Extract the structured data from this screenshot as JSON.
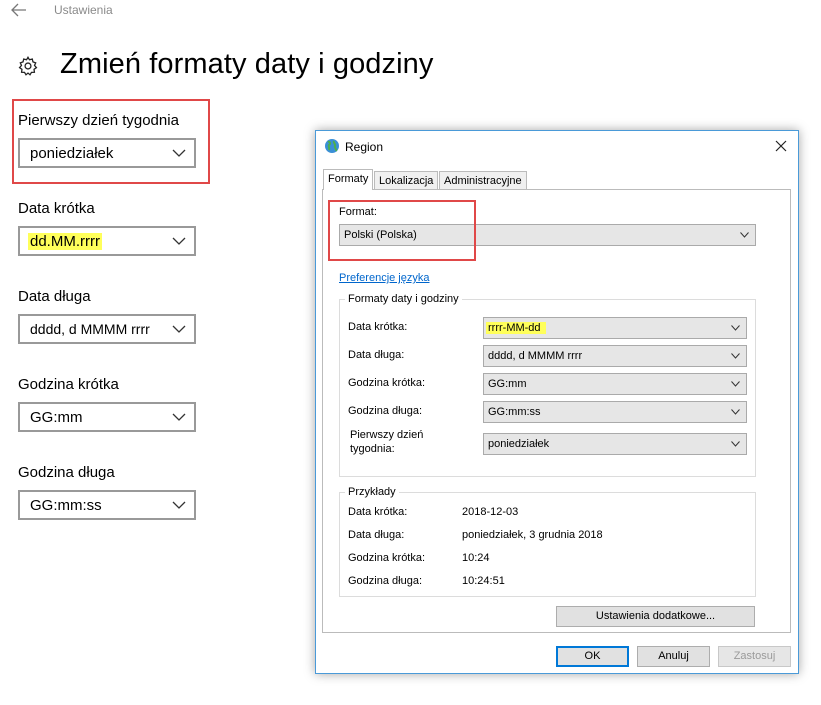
{
  "settings": {
    "app_title": "Ustawienia",
    "page_title": "Zmień formaty daty i godziny",
    "fields": [
      {
        "label": "Pierwszy dzień tygodnia",
        "value": "poniedziałek"
      },
      {
        "label": "Data krótka",
        "value": "dd.MM.rrrr"
      },
      {
        "label": "Data długa",
        "value": "dddd, d MMMM rrrr"
      },
      {
        "label": "Godzina krótka",
        "value": "GG:mm"
      },
      {
        "label": "Godzina długa",
        "value": "GG:mm:ss"
      }
    ]
  },
  "dialog": {
    "title": "Region",
    "tabs": [
      "Formaty",
      "Lokalizacja",
      "Administracyjne"
    ],
    "format_label": "Format:",
    "format_value": "Polski (Polska)",
    "language_pref_link": "Preferencje języka",
    "date_time_group": {
      "title": "Formaty daty i godziny",
      "rows": [
        {
          "label": "Data krótka:",
          "value": "rrrr-MM-dd"
        },
        {
          "label": "Data długa:",
          "value": "dddd, d MMMM rrrr"
        },
        {
          "label": "Godzina krótka:",
          "value": "GG:mm"
        },
        {
          "label": "Godzina długa:",
          "value": "GG:mm:ss"
        },
        {
          "label_line1": "Pierwszy dzień",
          "label_line2": "tygodnia:",
          "value": "poniedziałek"
        }
      ]
    },
    "examples_group": {
      "title": "Przykłady",
      "rows": [
        {
          "label": "Data krótka:",
          "value": "2018-12-03"
        },
        {
          "label": "Data długa:",
          "value": "poniedziałek, 3 grudnia 2018"
        },
        {
          "label": "Godzina krótka:",
          "value": "10:24"
        },
        {
          "label": "Godzina długa:",
          "value": "10:24:51"
        }
      ]
    },
    "additional_settings_label": "Ustawienia dodatkowe...",
    "ok_label": "OK",
    "cancel_label": "Anuluj",
    "apply_label": "Zastosuj"
  },
  "colors": {
    "highlight": "#ffff5a",
    "annotation_red": "#e04848",
    "link_blue": "#0066cc",
    "dialog_border": "#4a9ad8"
  },
  "icons": [
    "back-arrow-icon",
    "gear-icon",
    "globe-icon",
    "close-icon",
    "chevron-down-icon"
  ]
}
